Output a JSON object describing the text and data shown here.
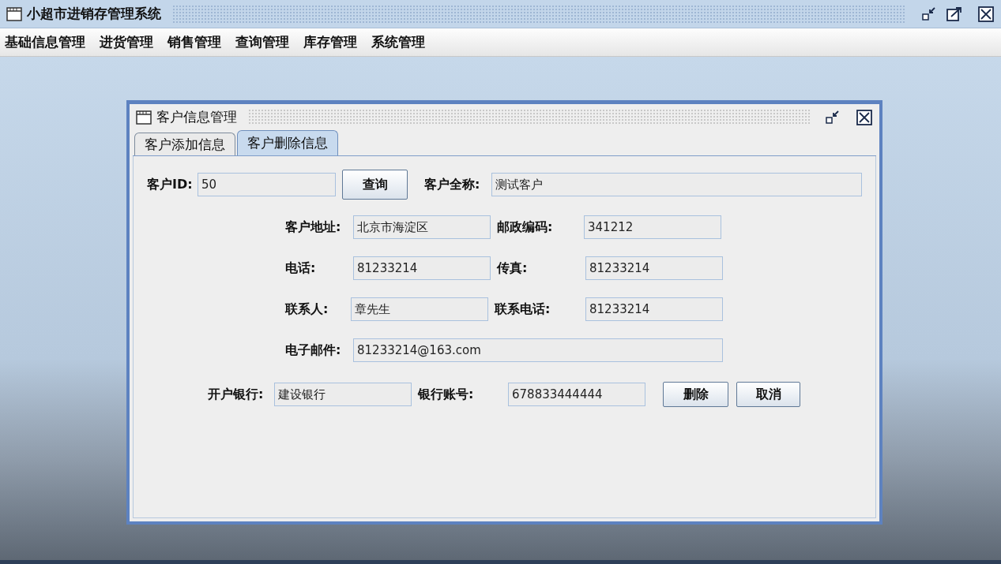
{
  "window": {
    "title": "小超市进销存管理系统"
  },
  "menu": [
    "基础信息管理",
    "进货管理",
    "销售管理",
    "查询管理",
    "库存管理",
    "系统管理"
  ],
  "dialog": {
    "title": "客户信息管理",
    "tabs": [
      {
        "label": "客户添加信息",
        "selected": false
      },
      {
        "label": "客户删除信息",
        "selected": true
      }
    ],
    "rows": [
      {
        "items": [
          {
            "kind": "field",
            "label": "客户ID:",
            "value": "50"
          },
          {
            "kind": "button",
            "label": "查询"
          },
          {
            "kind": "field",
            "label": "客户全称:",
            "value": "测试客户"
          }
        ]
      },
      {
        "items": [
          {
            "kind": "field",
            "label": "客户地址:",
            "value": "北京市海淀区"
          },
          {
            "kind": "field",
            "label": "邮政编码:",
            "value": "341212"
          }
        ]
      },
      {
        "items": [
          {
            "kind": "field",
            "label": "电话:",
            "value": "81233214"
          },
          {
            "kind": "field",
            "label": "传真:",
            "value": "81233214"
          }
        ]
      },
      {
        "items": [
          {
            "kind": "field",
            "label": "联系人:",
            "value": "章先生"
          },
          {
            "kind": "field",
            "label": "联系电话:",
            "value": "81233214"
          }
        ]
      },
      {
        "items": [
          {
            "kind": "field",
            "label": "电子邮件:",
            "value": "81233214@163.com"
          }
        ]
      },
      {
        "items": [
          {
            "kind": "field",
            "label": "开户银行:",
            "value": "建设银行"
          },
          {
            "kind": "field",
            "label": "银行账号:",
            "value": "678833444444"
          },
          {
            "kind": "button",
            "label": "删除"
          },
          {
            "kind": "button",
            "label": "取消"
          }
        ]
      }
    ]
  }
}
